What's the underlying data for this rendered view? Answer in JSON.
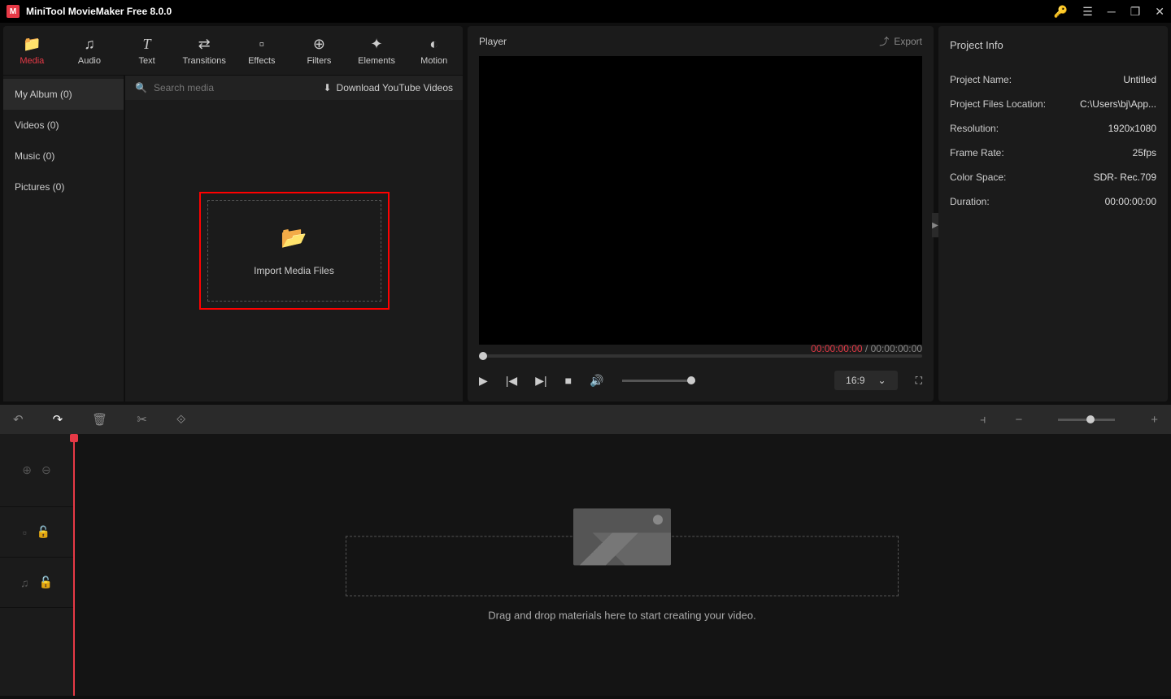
{
  "titlebar": {
    "app_title": "MiniTool MovieMaker Free 8.0.0"
  },
  "tabs": [
    {
      "label": "Media",
      "icon": "📁"
    },
    {
      "label": "Audio",
      "icon": "♫"
    },
    {
      "label": "Text",
      "icon": "T"
    },
    {
      "label": "Transitions",
      "icon": "⇄"
    },
    {
      "label": "Effects",
      "icon": "▫"
    },
    {
      "label": "Filters",
      "icon": "⊕"
    },
    {
      "label": "Elements",
      "icon": "✦"
    },
    {
      "label": "Motion",
      "icon": "◐"
    }
  ],
  "sidebar": [
    {
      "label": "My Album (0)"
    },
    {
      "label": "Videos (0)"
    },
    {
      "label": "Music (0)"
    },
    {
      "label": "Pictures (0)"
    }
  ],
  "media": {
    "search_placeholder": "Search media",
    "download_label": "Download YouTube Videos",
    "import_label": "Import Media Files"
  },
  "player": {
    "title": "Player",
    "export_label": "Export",
    "time_current": "00:00:00:00",
    "time_total": "00:00:00:00",
    "aspect": "16:9"
  },
  "project": {
    "heading": "Project Info",
    "rows": [
      {
        "label": "Project Name:",
        "value": "Untitled"
      },
      {
        "label": "Project Files Location:",
        "value": "C:\\Users\\bj\\App..."
      },
      {
        "label": "Resolution:",
        "value": "1920x1080"
      },
      {
        "label": "Frame Rate:",
        "value": "25fps"
      },
      {
        "label": "Color Space:",
        "value": "SDR- Rec.709"
      },
      {
        "label": "Duration:",
        "value": "00:00:00:00"
      }
    ]
  },
  "timeline": {
    "empty_text": "Drag and drop materials here to start creating your video."
  }
}
